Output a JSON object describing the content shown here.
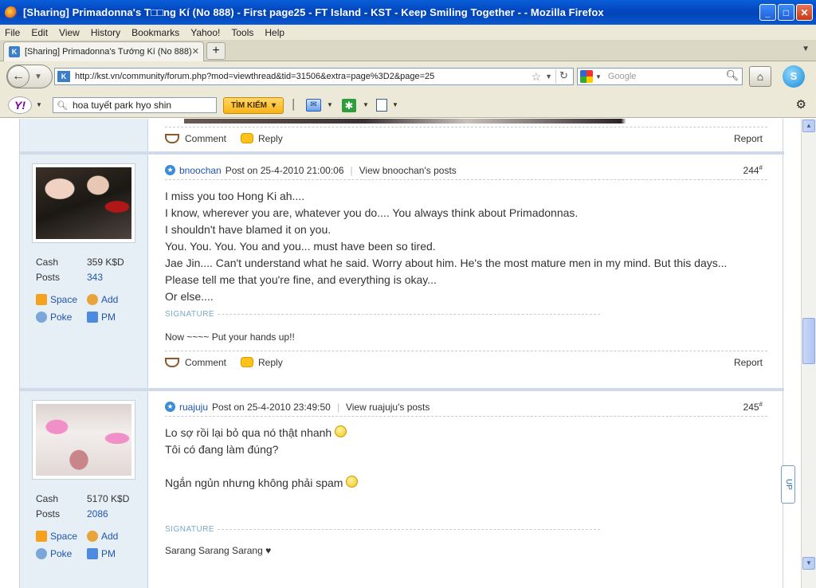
{
  "window": {
    "title": "[Sharing] Primadonna's T□□ng Kí (No 888) - First page25 - FT Island - KST - Keep Smiling Together - - Mozilla Firefox",
    "buttons": {
      "minimize": "_",
      "maximize": "□",
      "close": "✕"
    }
  },
  "menu": [
    "File",
    "Edit",
    "View",
    "History",
    "Bookmarks",
    "Yahoo!",
    "Tools",
    "Help"
  ],
  "tabs": [
    {
      "label": "[Sharing] Primadonna's Tướng Kí (No 888) - ...",
      "close": "✕"
    }
  ],
  "tabbar": {
    "new_tab": "+",
    "list_arrow": "▼"
  },
  "nav": {
    "url": "http://kst.vn/community/forum.php?mod=viewthread&tid=31506&extra=page%3D2&page=25",
    "search_placeholder": "Google",
    "skype_label": "S"
  },
  "yahoo": {
    "logo": "Y!",
    "search_value": "hoa tuyết park hyo shin",
    "search_button": "TÌM KIẾM"
  },
  "posts": [
    {
      "actions": {
        "comment": "Comment",
        "reply": "Reply",
        "report": "Report"
      }
    },
    {
      "author": "bnoochan",
      "posted": "Post on 25-4-2010 21:00:06",
      "view_posts": "View bnoochan's posts",
      "floor": "244",
      "floor_mark": "#",
      "stats": {
        "cash_label": "Cash",
        "cash_value": "359 K$D",
        "posts_label": "Posts",
        "posts_value": "343"
      },
      "links": {
        "space": "Space",
        "add": "Add",
        "poke": "Poke",
        "pm": "PM"
      },
      "message": [
        "I miss you too Hong Ki ah....",
        "I know, wherever you are, whatever you do.... You always think about Primadonnas.",
        "I shouldn't have blamed it on you.",
        "You. You. You. You and you... must have been so tired.",
        "Jae Jin.... Can't understand what he said. Worry about him. He's the most mature men in my mind. But this days...",
        "Please tell me that you're fine, and everything is okay...",
        "Or else...."
      ],
      "signature_label": "SIGNATURE",
      "signature": "Now ~~~~ Put your hands up!!",
      "actions": {
        "comment": "Comment",
        "reply": "Reply",
        "report": "Report"
      }
    },
    {
      "author": "ruajuju",
      "posted": "Post on 25-4-2010 23:49:50",
      "view_posts": "View ruajuju's posts",
      "floor": "245",
      "floor_mark": "#",
      "stats": {
        "cash_label": "Cash",
        "cash_value": "5170 K$D",
        "posts_label": "Posts",
        "posts_value": "2086"
      },
      "links": {
        "space": "Space",
        "add": "Add",
        "poke": "Poke",
        "pm": "PM"
      },
      "message": [
        "Lo sợ rồi lại bỏ qua nó thật nhanh",
        "Tôi có đang làm đúng?",
        "Ngắn ngủn nhưng không phải spam"
      ],
      "signature_label": "SIGNATURE",
      "signature": "Sarang Sarang Sarang ♥"
    }
  ],
  "side_widget": "UP"
}
